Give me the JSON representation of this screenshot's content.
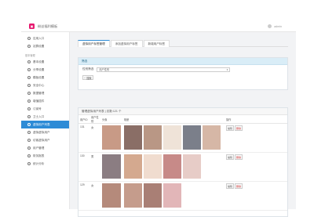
{
  "header": {
    "app_name": "粉丝福利模板",
    "user_name": "admin",
    "logo_icon": "bag-icon"
  },
  "sidebar": {
    "items_top": [
      {
        "label": "应用入口"
      },
      {
        "label": "站群设置"
      }
    ],
    "section": "基本管理",
    "items": [
      {
        "label": "基本设置",
        "active": false
      },
      {
        "label": "分享设置",
        "active": false
      },
      {
        "label": "模板设置",
        "active": false
      },
      {
        "label": "安全中心",
        "active": false
      },
      {
        "label": "数据管理",
        "active": false
      },
      {
        "label": "增值插件",
        "active": false
      },
      {
        "label": "订阅号",
        "active": false
      },
      {
        "label": "卫士入口",
        "active": false
      },
      {
        "label": "虚拟用户列表",
        "active": true
      },
      {
        "label": "虚拟虚拟用户",
        "active": false
      },
      {
        "label": "访客虚拟用户",
        "active": false
      },
      {
        "label": "用户管理",
        "active": false
      },
      {
        "label": "财务报表",
        "active": false
      },
      {
        "label": "统计分析",
        "active": false
      }
    ],
    "accent": "#2d8bd6"
  },
  "tabs": [
    "虚拟用户标签管理",
    "添加虚拟用户标签",
    "新增用户标签"
  ],
  "filter": {
    "title": "筛选",
    "label": "性别筛选",
    "select_value": "用户性别",
    "search_label": "搜索"
  },
  "list": {
    "title": "管理虚拟用户列表 | 总数:121 个",
    "columns": [
      "用户ID",
      "用户性别",
      "头像",
      "相册",
      "操作"
    ],
    "rows": [
      {
        "id": "131",
        "gender": "女",
        "edit": "编辑",
        "delete": "删除",
        "avatar": "#c89a86",
        "photos": [
          "#8a6e66",
          "#b99785",
          "#efe3d8",
          "#7b7f8a",
          "#d6b7a6"
        ]
      },
      {
        "id": "130",
        "gender": "男",
        "edit": "编辑",
        "delete": "删除",
        "avatar": "#8b7d82",
        "photos": [
          "#d4a98f",
          "#f0dccf",
          "#c78a88",
          "#e7ccc7"
        ]
      },
      {
        "id": "129",
        "gender": "女",
        "edit": "编辑",
        "delete": "删除",
        "avatar": "#b58a7b",
        "photos": [
          "#c59c8c",
          "#a97f75",
          "#e2b6b8"
        ]
      }
    ]
  }
}
